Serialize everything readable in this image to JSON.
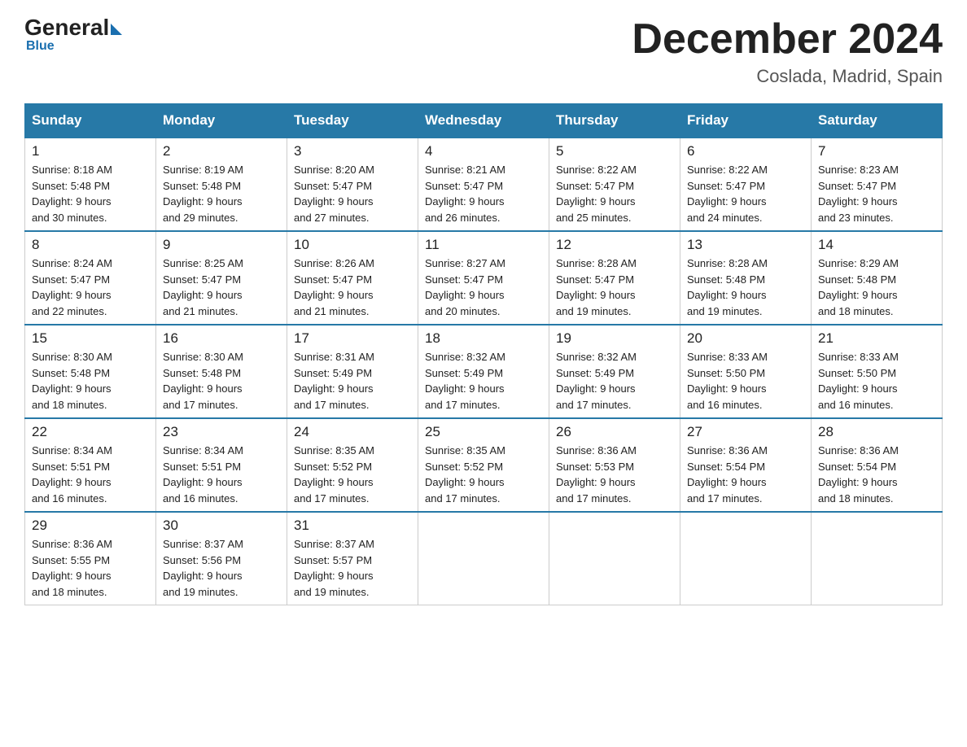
{
  "logo": {
    "general": "General",
    "blue": "Blue"
  },
  "title": "December 2024",
  "location": "Coslada, Madrid, Spain",
  "days_of_week": [
    "Sunday",
    "Monday",
    "Tuesday",
    "Wednesday",
    "Thursday",
    "Friday",
    "Saturday"
  ],
  "weeks": [
    [
      {
        "day": "1",
        "sunrise": "8:18 AM",
        "sunset": "5:48 PM",
        "daylight": "9 hours and 30 minutes."
      },
      {
        "day": "2",
        "sunrise": "8:19 AM",
        "sunset": "5:48 PM",
        "daylight": "9 hours and 29 minutes."
      },
      {
        "day": "3",
        "sunrise": "8:20 AM",
        "sunset": "5:47 PM",
        "daylight": "9 hours and 27 minutes."
      },
      {
        "day": "4",
        "sunrise": "8:21 AM",
        "sunset": "5:47 PM",
        "daylight": "9 hours and 26 minutes."
      },
      {
        "day": "5",
        "sunrise": "8:22 AM",
        "sunset": "5:47 PM",
        "daylight": "9 hours and 25 minutes."
      },
      {
        "day": "6",
        "sunrise": "8:22 AM",
        "sunset": "5:47 PM",
        "daylight": "9 hours and 24 minutes."
      },
      {
        "day": "7",
        "sunrise": "8:23 AM",
        "sunset": "5:47 PM",
        "daylight": "9 hours and 23 minutes."
      }
    ],
    [
      {
        "day": "8",
        "sunrise": "8:24 AM",
        "sunset": "5:47 PM",
        "daylight": "9 hours and 22 minutes."
      },
      {
        "day": "9",
        "sunrise": "8:25 AM",
        "sunset": "5:47 PM",
        "daylight": "9 hours and 21 minutes."
      },
      {
        "day": "10",
        "sunrise": "8:26 AM",
        "sunset": "5:47 PM",
        "daylight": "9 hours and 21 minutes."
      },
      {
        "day": "11",
        "sunrise": "8:27 AM",
        "sunset": "5:47 PM",
        "daylight": "9 hours and 20 minutes."
      },
      {
        "day": "12",
        "sunrise": "8:28 AM",
        "sunset": "5:47 PM",
        "daylight": "9 hours and 19 minutes."
      },
      {
        "day": "13",
        "sunrise": "8:28 AM",
        "sunset": "5:48 PM",
        "daylight": "9 hours and 19 minutes."
      },
      {
        "day": "14",
        "sunrise": "8:29 AM",
        "sunset": "5:48 PM",
        "daylight": "9 hours and 18 minutes."
      }
    ],
    [
      {
        "day": "15",
        "sunrise": "8:30 AM",
        "sunset": "5:48 PM",
        "daylight": "9 hours and 18 minutes."
      },
      {
        "day": "16",
        "sunrise": "8:30 AM",
        "sunset": "5:48 PM",
        "daylight": "9 hours and 17 minutes."
      },
      {
        "day": "17",
        "sunrise": "8:31 AM",
        "sunset": "5:49 PM",
        "daylight": "9 hours and 17 minutes."
      },
      {
        "day": "18",
        "sunrise": "8:32 AM",
        "sunset": "5:49 PM",
        "daylight": "9 hours and 17 minutes."
      },
      {
        "day": "19",
        "sunrise": "8:32 AM",
        "sunset": "5:49 PM",
        "daylight": "9 hours and 17 minutes."
      },
      {
        "day": "20",
        "sunrise": "8:33 AM",
        "sunset": "5:50 PM",
        "daylight": "9 hours and 16 minutes."
      },
      {
        "day": "21",
        "sunrise": "8:33 AM",
        "sunset": "5:50 PM",
        "daylight": "9 hours and 16 minutes."
      }
    ],
    [
      {
        "day": "22",
        "sunrise": "8:34 AM",
        "sunset": "5:51 PM",
        "daylight": "9 hours and 16 minutes."
      },
      {
        "day": "23",
        "sunrise": "8:34 AM",
        "sunset": "5:51 PM",
        "daylight": "9 hours and 16 minutes."
      },
      {
        "day": "24",
        "sunrise": "8:35 AM",
        "sunset": "5:52 PM",
        "daylight": "9 hours and 17 minutes."
      },
      {
        "day": "25",
        "sunrise": "8:35 AM",
        "sunset": "5:52 PM",
        "daylight": "9 hours and 17 minutes."
      },
      {
        "day": "26",
        "sunrise": "8:36 AM",
        "sunset": "5:53 PM",
        "daylight": "9 hours and 17 minutes."
      },
      {
        "day": "27",
        "sunrise": "8:36 AM",
        "sunset": "5:54 PM",
        "daylight": "9 hours and 17 minutes."
      },
      {
        "day": "28",
        "sunrise": "8:36 AM",
        "sunset": "5:54 PM",
        "daylight": "9 hours and 18 minutes."
      }
    ],
    [
      {
        "day": "29",
        "sunrise": "8:36 AM",
        "sunset": "5:55 PM",
        "daylight": "9 hours and 18 minutes."
      },
      {
        "day": "30",
        "sunrise": "8:37 AM",
        "sunset": "5:56 PM",
        "daylight": "9 hours and 19 minutes."
      },
      {
        "day": "31",
        "sunrise": "8:37 AM",
        "sunset": "5:57 PM",
        "daylight": "9 hours and 19 minutes."
      },
      null,
      null,
      null,
      null
    ]
  ],
  "labels": {
    "sunrise": "Sunrise:",
    "sunset": "Sunset:",
    "daylight": "Daylight:"
  }
}
